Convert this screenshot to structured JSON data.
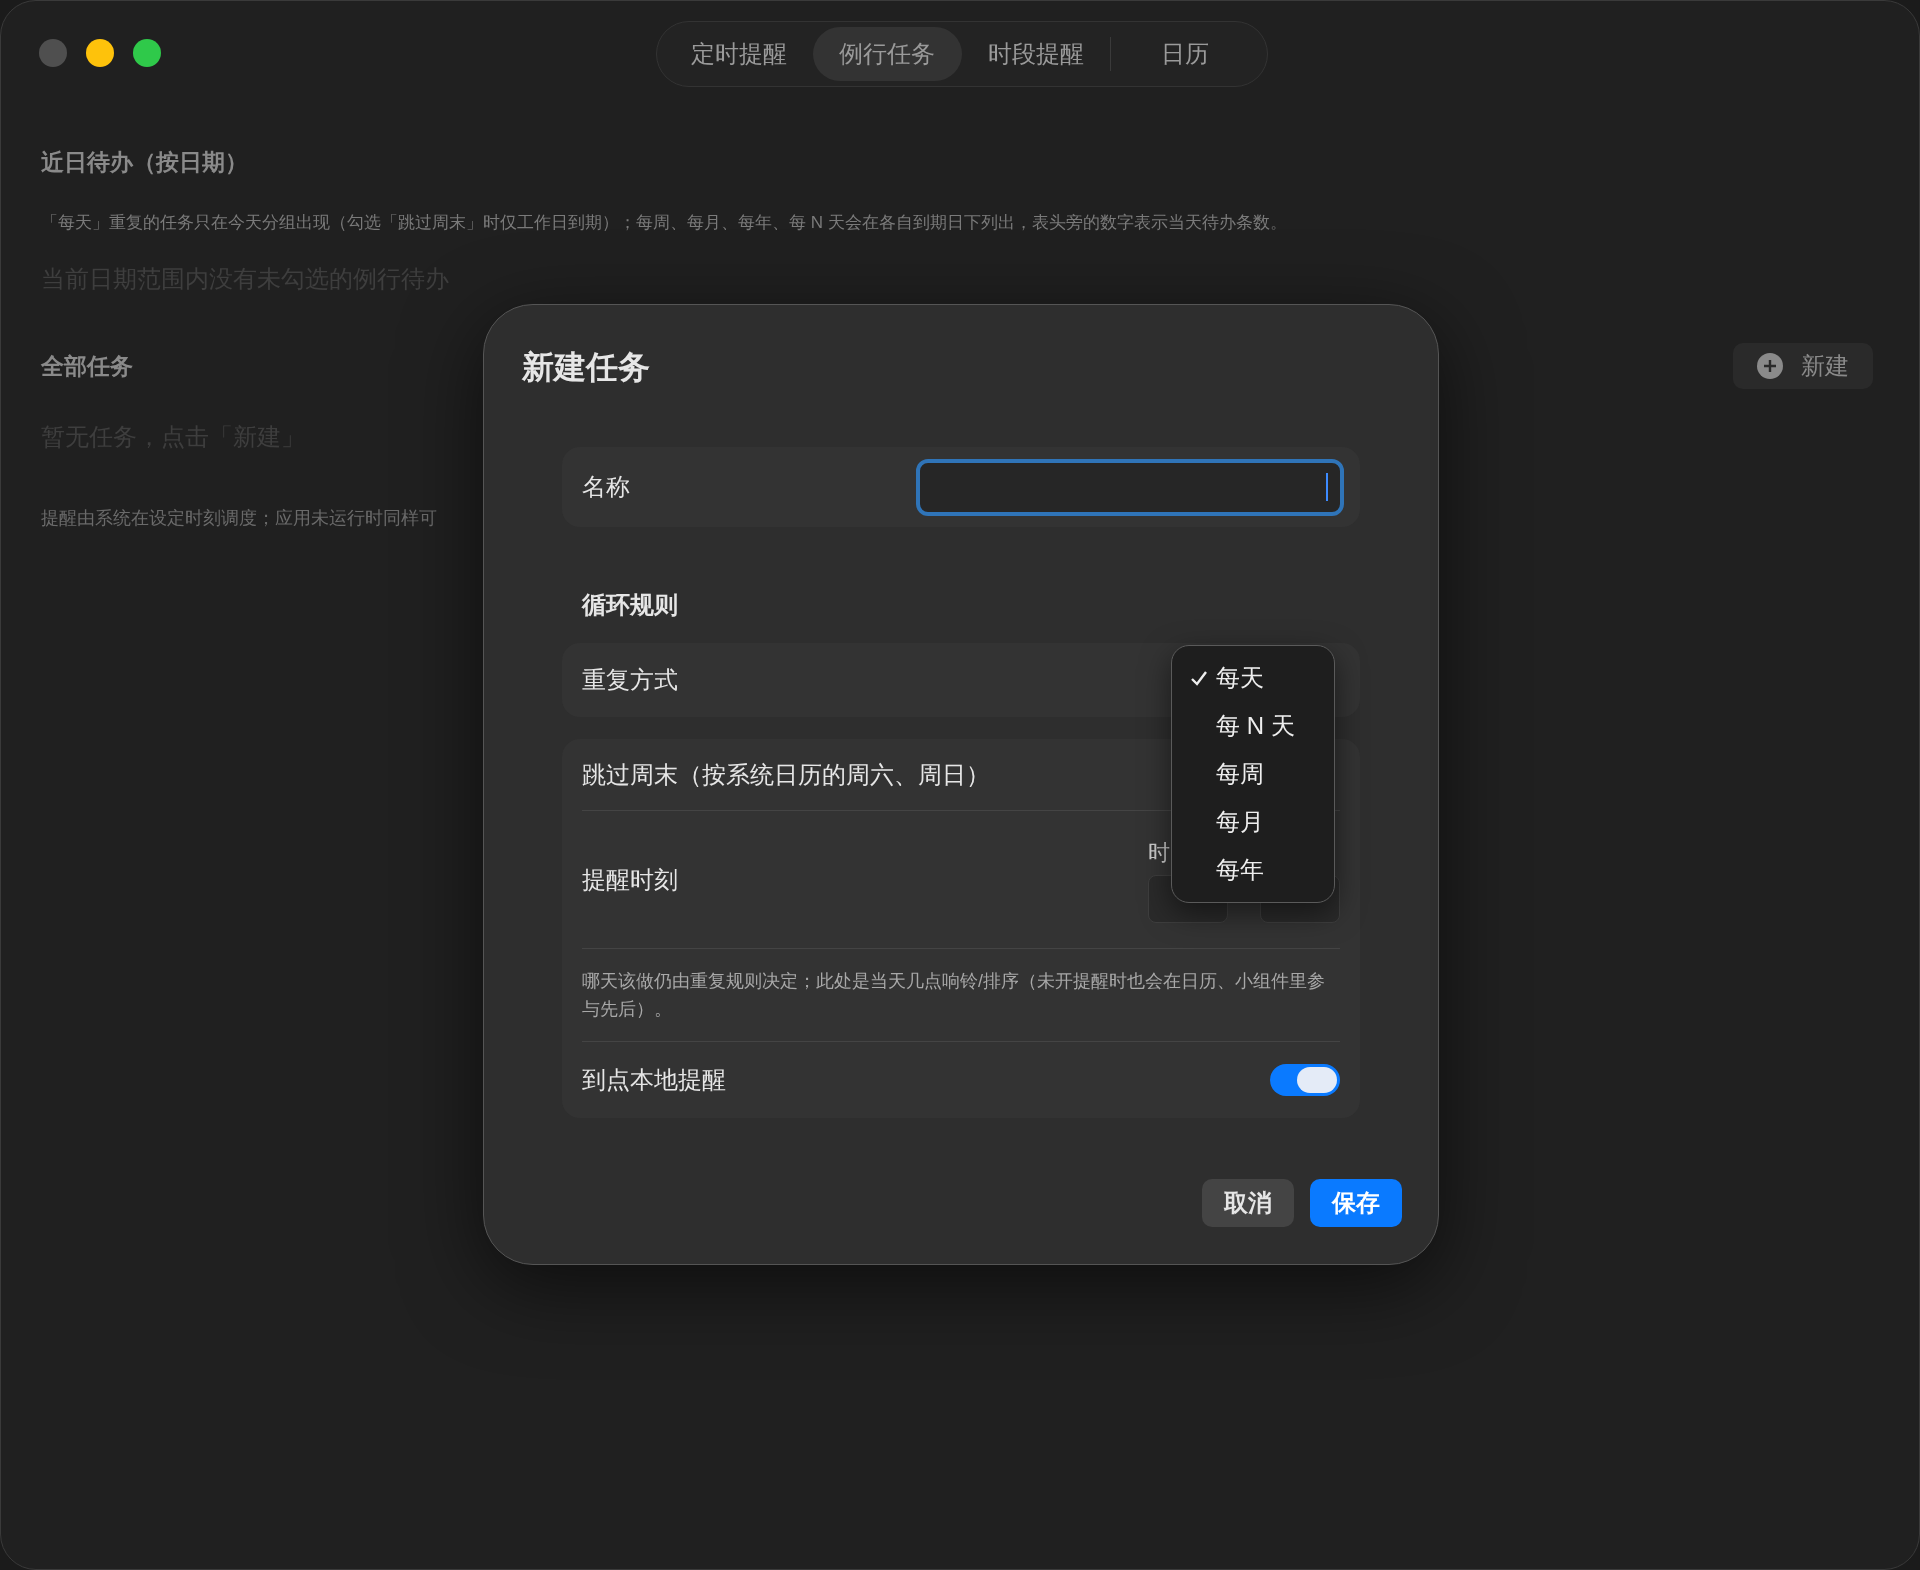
{
  "tabs": [
    {
      "label": "定时提醒",
      "selected": false
    },
    {
      "label": "例行任务",
      "selected": true
    },
    {
      "label": "时段提醒",
      "selected": false
    },
    {
      "label": "日历",
      "selected": false
    }
  ],
  "upcoming": {
    "title": "近日待办（按日期）",
    "description": "「每天」重复的任务只在今天分组出现（勾选「跳过周末」时仅工作日到期）；每周、每月、每年、每 N 天会在各自到期日下列出，表头旁的数字表示当天待办条数。",
    "empty": "当前日期范围内没有未勾选的例行待办"
  },
  "all_tasks": {
    "title": "全部任务",
    "new_button": "新建",
    "empty": "暂无任务，点击「新建」",
    "footnote": "提醒由系统在设定时刻调度；应用未运行时同样可"
  },
  "dialog": {
    "title": "新建任务",
    "name_label": "名称",
    "name_focused": true,
    "section": "循环规则",
    "repeat_label": "重复方式",
    "skip_weekend_label": "跳过周末（按系统日历的周六、周日）",
    "time_label": "提醒时刻",
    "hour_label": "时",
    "note": "哪天该做仍由重复规则决定；此处是当天几点响铃/排序（未开提醒时也会在日历、小组件里参与先后）。",
    "local_alert": {
      "label": "到点本地提醒",
      "on": true
    },
    "buttons": [
      {
        "label": "取消",
        "kind": "secondary"
      },
      {
        "label": "保存",
        "kind": "primary"
      }
    ]
  },
  "repeat_menu": [
    {
      "label": "每天",
      "selected": true
    },
    {
      "label": "每 N 天",
      "selected": false
    },
    {
      "label": "每周",
      "selected": false
    },
    {
      "label": "每月",
      "selected": false
    },
    {
      "label": "每年",
      "selected": false
    }
  ]
}
